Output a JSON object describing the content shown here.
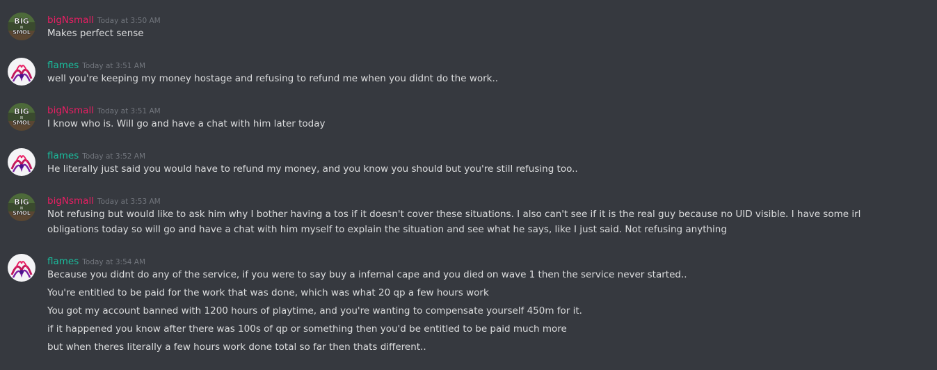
{
  "colors": {
    "background": "#36393f",
    "bigNsmall_name": "#e91e63",
    "flames_name": "#1abc9c",
    "timestamp": "#72767d",
    "message_text": "#dcddde"
  },
  "avatars": {
    "bigNsmall": {
      "icon": "big-n-smol-avatar-icon",
      "logo_text": [
        "BIG",
        "N",
        "SMOL"
      ]
    },
    "flames": {
      "icon": "flames-avatar-icon"
    }
  },
  "messages": [
    {
      "author": "bigNsmall",
      "timestamp": "Today at 3:50 AM",
      "lines": [
        "Makes perfect sense"
      ]
    },
    {
      "author": "flames",
      "timestamp": "Today at 3:51 AM",
      "lines": [
        "well you're keeping my money hostage and refusing to refund me when you didnt do the work.."
      ]
    },
    {
      "author": "bigNsmall",
      "timestamp": "Today at 3:51 AM",
      "lines": [
        "I know who is. Will go and have a chat with him later today"
      ]
    },
    {
      "author": "flames",
      "timestamp": "Today at 3:52 AM",
      "lines": [
        "He literally just said you would have to refund my money, and you know you should but you're still refusing too.."
      ]
    },
    {
      "author": "bigNsmall",
      "timestamp": "Today at 3:53 AM",
      "lines": [
        "Not refusing but would like to ask him why I bother having a tos if it doesn't cover these situations. I also can't see if it is the real guy because no UID visible. I have some irl obligations today so will go and have a chat with him myself to explain the situation and see what he says, like I just said. Not refusing anything"
      ]
    },
    {
      "author": "flames",
      "timestamp": "Today at 3:54 AM",
      "lines": [
        "Because you didnt do any of the service, if you were to say buy a infernal cape and you died on wave 1 then the service never started..",
        "You're entitled to be paid for the work that was done, which was what 20 qp a few hours work",
        "You got my account banned with 1200 hours of playtime, and you're wanting to compensate yourself 450m for it.",
        "if it happened you know after there was 100s of qp or something then you'd be entitled to be paid much more",
        "but when theres literally a few hours work done total so far then thats different.."
      ]
    }
  ]
}
